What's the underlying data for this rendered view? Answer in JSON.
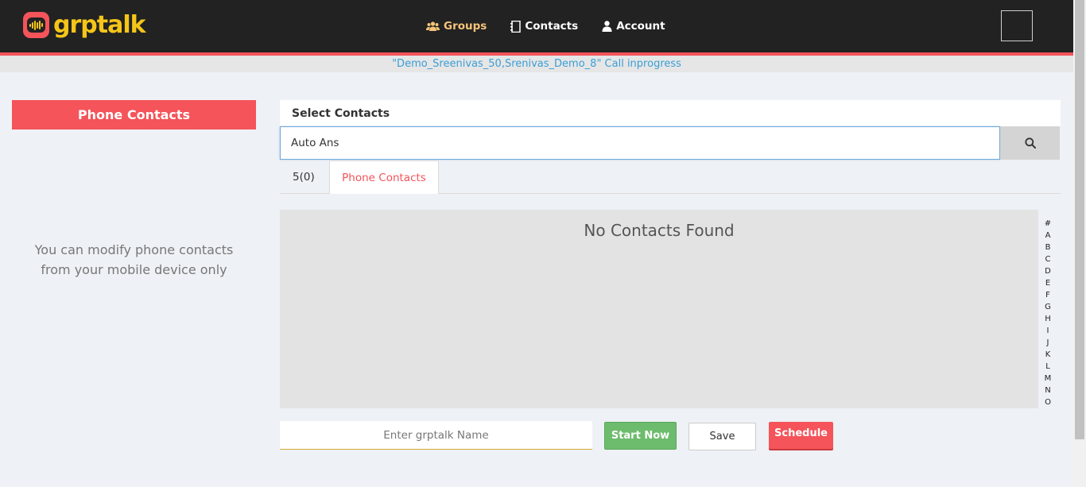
{
  "app": {
    "logo_text": "grptalk",
    "brand_colors": {
      "header_bg": "#222222",
      "accent": "#f4545a",
      "logo_yellow": "#f5c518",
      "active_nav": "#f5c47a",
      "link_blue": "#3b9ed6",
      "success": "#6dbc6d"
    }
  },
  "nav": {
    "items": [
      {
        "label": "Groups",
        "icon": "groups-icon",
        "active": true
      },
      {
        "label": "Contacts",
        "icon": "address-book-icon",
        "active": false
      },
      {
        "label": "Account",
        "icon": "user-icon",
        "active": false
      }
    ]
  },
  "status": {
    "text": "\"Demo_Sreenivas_50,Srenivas_Demo_8\" Call inprogress"
  },
  "left_panel": {
    "title": "Phone Contacts",
    "note_line1": "You can modify phone contacts",
    "note_line2": "from your mobile device only"
  },
  "main": {
    "select_heading": "Select Contacts",
    "search": {
      "value": "Auto Ans",
      "icon": "search-icon"
    },
    "tabs": [
      {
        "label": "5(0)",
        "active": false
      },
      {
        "label": "Phone Contacts",
        "active": true
      }
    ],
    "empty_message": "No Contacts Found",
    "alphabet": [
      "#",
      "A",
      "B",
      "C",
      "D",
      "E",
      "F",
      "G",
      "H",
      "I",
      "J",
      "K",
      "L",
      "M",
      "N",
      "O"
    ]
  },
  "footer": {
    "name_placeholder": "Enter grptalk Name",
    "start_label": "Start Now",
    "save_label": "Save",
    "schedule_label": "Schedule"
  }
}
